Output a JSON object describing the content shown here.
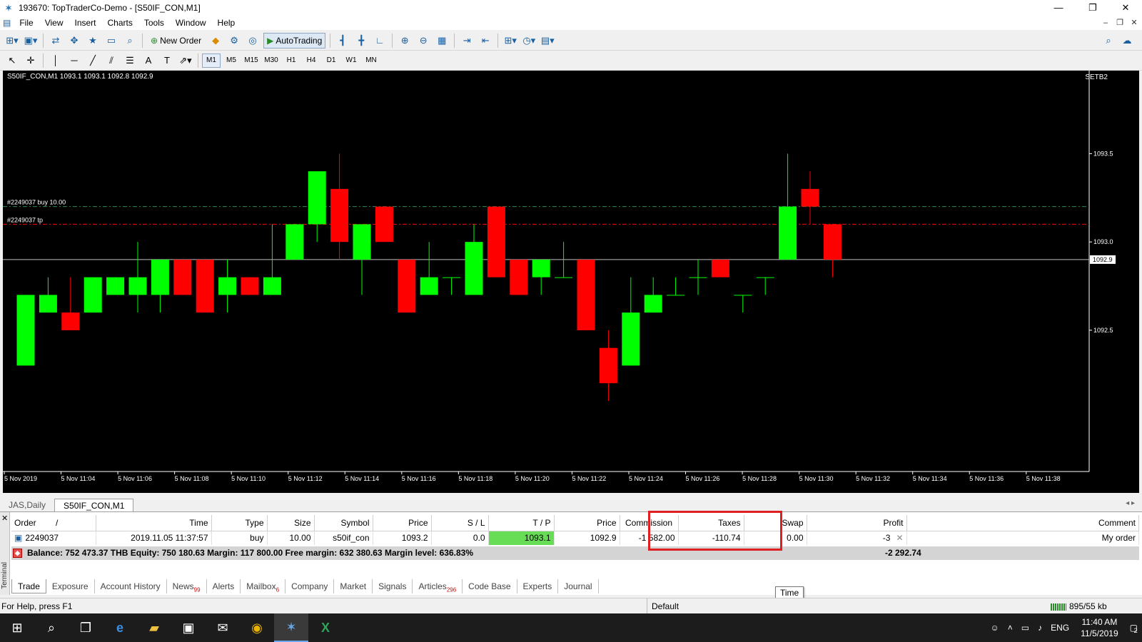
{
  "window": {
    "title": "193670: TopTraderCo-Demo - [S50IF_CON,M1]"
  },
  "menu": [
    "File",
    "View",
    "Insert",
    "Charts",
    "Tools",
    "Window",
    "Help"
  ],
  "toolbar": {
    "new_order": "New Order",
    "autotrading": "AutoTrading"
  },
  "timeframes": [
    "M1",
    "M5",
    "M15",
    "M30",
    "H1",
    "H4",
    "D1",
    "W1",
    "MN"
  ],
  "chart": {
    "info": "S50IF_CON,M1  1093.1 1093.1 1092.8 1092.9",
    "server": "SETB2",
    "order_line_buy": "#2249037 buy 10.00",
    "order_line_tp": "#2249037 tp",
    "current_price": "1092.9"
  },
  "chart_data": {
    "type": "candlestick",
    "price_axis": [
      "1093.5",
      "1093.0",
      "1092.5"
    ],
    "ylim": [
      1091.7,
      1093.97
    ],
    "time_axis": [
      "5 Nov 2019",
      "5 Nov 11:04",
      "5 Nov 11:06",
      "5 Nov 11:08",
      "5 Nov 11:10",
      "5 Nov 11:12",
      "5 Nov 11:14",
      "5 Nov 11:16",
      "5 Nov 11:18",
      "5 Nov 11:20",
      "5 Nov 11:22",
      "5 Nov 11:24",
      "5 Nov 11:26",
      "5 Nov 11:28",
      "5 Nov 11:30",
      "5 Nov 11:32",
      "5 Nov 11:34",
      "5 Nov 11:36",
      "5 Nov 11:38"
    ],
    "buy_price": 1093.2,
    "tp_price": 1093.1,
    "bid": 1092.9,
    "colors": {
      "bull": "#00ff00",
      "bear": "#ff0000",
      "buy_line": "#2e8b57",
      "tp_line": "#ff0000",
      "bid_line": "#c0c0c0"
    },
    "candles": [
      {
        "o": 1092.3,
        "h": 1092.7,
        "l": 1092.3,
        "c": 1092.7
      },
      {
        "o": 1092.6,
        "h": 1092.8,
        "l": 1092.6,
        "c": 1092.7
      },
      {
        "o": 1092.6,
        "h": 1092.8,
        "l": 1092.5,
        "c": 1092.5
      },
      {
        "o": 1092.6,
        "h": 1092.8,
        "l": 1092.6,
        "c": 1092.8
      },
      {
        "o": 1092.7,
        "h": 1092.8,
        "l": 1092.7,
        "c": 1092.8
      },
      {
        "o": 1092.7,
        "h": 1093.0,
        "l": 1092.6,
        "c": 1092.8
      },
      {
        "o": 1092.7,
        "h": 1092.9,
        "l": 1092.6,
        "c": 1092.9
      },
      {
        "o": 1092.9,
        "h": 1092.9,
        "l": 1092.7,
        "c": 1092.7
      },
      {
        "o": 1092.9,
        "h": 1092.9,
        "l": 1092.6,
        "c": 1092.6
      },
      {
        "o": 1092.7,
        "h": 1092.9,
        "l": 1092.6,
        "c": 1092.8
      },
      {
        "o": 1092.8,
        "h": 1092.8,
        "l": 1092.7,
        "c": 1092.7
      },
      {
        "o": 1092.7,
        "h": 1093.1,
        "l": 1092.7,
        "c": 1092.8
      },
      {
        "o": 1092.9,
        "h": 1093.1,
        "l": 1092.9,
        "c": 1093.1
      },
      {
        "o": 1093.1,
        "h": 1093.4,
        "l": 1093.0,
        "c": 1093.4
      },
      {
        "o": 1093.3,
        "h": 1093.5,
        "l": 1092.9,
        "c": 1093.0
      },
      {
        "o": 1092.9,
        "h": 1093.1,
        "l": 1092.7,
        "c": 1093.1
      },
      {
        "o": 1093.2,
        "h": 1093.2,
        "l": 1093.0,
        "c": 1093.0
      },
      {
        "o": 1092.9,
        "h": 1092.9,
        "l": 1092.6,
        "c": 1092.6
      },
      {
        "o": 1092.7,
        "h": 1093.0,
        "l": 1092.7,
        "c": 1092.8
      },
      {
        "o": 1092.8,
        "h": 1092.8,
        "l": 1092.7,
        "c": 1092.8
      },
      {
        "o": 1092.7,
        "h": 1093.1,
        "l": 1092.7,
        "c": 1093.0
      },
      {
        "o": 1093.2,
        "h": 1093.2,
        "l": 1092.8,
        "c": 1092.8
      },
      {
        "o": 1092.9,
        "h": 1092.9,
        "l": 1092.7,
        "c": 1092.7
      },
      {
        "o": 1092.8,
        "h": 1092.9,
        "l": 1092.7,
        "c": 1092.9
      },
      {
        "o": 1092.8,
        "h": 1093.0,
        "l": 1092.8,
        "c": 1092.8
      },
      {
        "o": 1092.9,
        "h": 1092.9,
        "l": 1092.5,
        "c": 1092.5
      },
      {
        "o": 1092.4,
        "h": 1092.5,
        "l": 1092.1,
        "c": 1092.2
      },
      {
        "o": 1092.3,
        "h": 1092.8,
        "l": 1092.3,
        "c": 1092.6
      },
      {
        "o": 1092.6,
        "h": 1092.8,
        "l": 1092.6,
        "c": 1092.7
      },
      {
        "o": 1092.7,
        "h": 1092.8,
        "l": 1092.7,
        "c": 1092.7
      },
      {
        "o": 1092.8,
        "h": 1092.9,
        "l": 1092.7,
        "c": 1092.8
      },
      {
        "o": 1092.9,
        "h": 1092.9,
        "l": 1092.8,
        "c": 1092.8
      },
      {
        "o": 1092.7,
        "h": 1092.7,
        "l": 1092.6,
        "c": 1092.7
      },
      {
        "o": 1092.8,
        "h": 1092.8,
        "l": 1092.7,
        "c": 1092.8
      },
      {
        "o": 1092.9,
        "h": 1093.5,
        "l": 1092.9,
        "c": 1093.2
      },
      {
        "o": 1093.3,
        "h": 1093.4,
        "l": 1093.1,
        "c": 1093.2
      },
      {
        "o": 1093.1,
        "h": 1093.1,
        "l": 1092.8,
        "c": 1092.9
      }
    ]
  },
  "chart_tabs": [
    "JAS,Daily",
    "S50IF_CON,M1"
  ],
  "terminal": {
    "side_label": "Terminal",
    "columns": [
      "Order",
      "/",
      "Time",
      "Type",
      "Size",
      "Symbol",
      "Price",
      "S / L",
      "T / P",
      "Price",
      "Commission",
      "Taxes",
      "Swap",
      "Profit",
      "Comment"
    ],
    "row": {
      "order": "2249037",
      "time": "2019.11.05 11:37:57",
      "type": "buy",
      "size": "10.00",
      "symbol": "s50if_con",
      "price": "1093.2",
      "sl": "0.0",
      "tp": "1093.1",
      "cur_price": "1092.9",
      "commission": "-1 582.00",
      "taxes": "-110.74",
      "swap": "0.00",
      "profit": "-3",
      "comment": "My order"
    },
    "balance_text": "Balance: 752 473.37 THB  Equity: 750 180.63  Margin: 117 800.00  Free margin: 632 380.63  Margin level: 636.83%",
    "balance_profit": "-2 292.74",
    "tabs": [
      "Trade",
      "Exposure",
      "Account History",
      "News",
      "Alerts",
      "Mailbox",
      "Company",
      "Market",
      "Signals",
      "Articles",
      "Code Base",
      "Experts",
      "Journal"
    ],
    "badges": {
      "news": "99",
      "mailbox": "6",
      "articles": "296"
    },
    "tooltip": "Time"
  },
  "status": {
    "help": "For Help, press F1",
    "profile": "Default",
    "traffic": "895/55 kb"
  },
  "taskbar": {
    "lang": "ENG",
    "time": "11:40 AM",
    "date": "11/5/2019",
    "notif": "2"
  }
}
